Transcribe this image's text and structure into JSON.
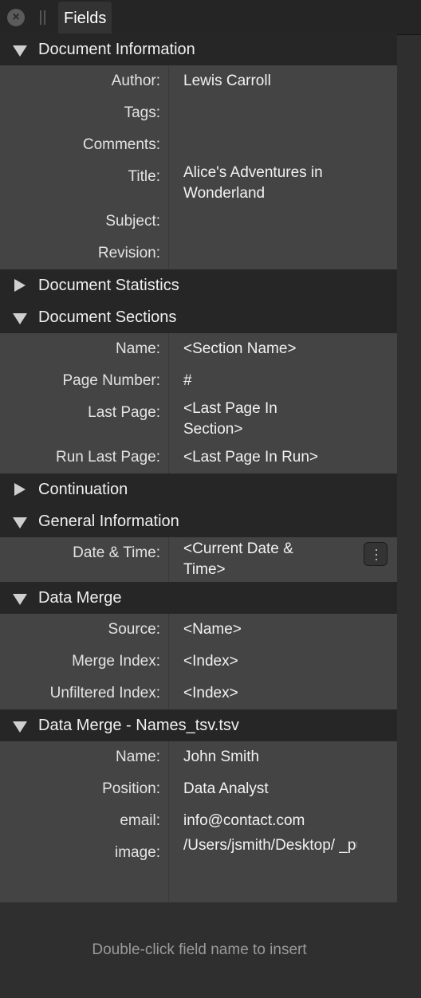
{
  "tabbar": {
    "tab_label": "Fields",
    "close_icon": "close-icon",
    "grip_icon": "drag-grip-icon"
  },
  "sections": {
    "document_information": {
      "title": "Document Information",
      "rows": {
        "author": {
          "label": "Author:",
          "value": "Lewis Carroll"
        },
        "tags": {
          "label": "Tags:",
          "value": ""
        },
        "comments": {
          "label": "Comments:",
          "value": ""
        },
        "title": {
          "label": "Title:",
          "value": "Alice's Adventures in\nWonderland"
        },
        "subject": {
          "label": "Subject:",
          "value": ""
        },
        "revision": {
          "label": "Revision:",
          "value": ""
        }
      }
    },
    "document_statistics": {
      "title": "Document Statistics"
    },
    "document_sections": {
      "title": "Document Sections",
      "rows": {
        "name": {
          "label": "Name:",
          "value": "<Section Name>"
        },
        "page_number": {
          "label": "Page Number:",
          "value": "#"
        },
        "last_page": {
          "label": "Last Page:",
          "value": "<Last Page In\nSection>"
        },
        "run_last_page": {
          "label": "Run Last Page:",
          "value": "<Last Page In Run>"
        }
      }
    },
    "continuation": {
      "title": "Continuation"
    },
    "general_information": {
      "title": "General Information",
      "rows": {
        "date_time": {
          "label": "Date & Time:",
          "value": "<Current Date &\nTime>"
        }
      }
    },
    "data_merge": {
      "title": "Data Merge",
      "rows": {
        "source": {
          "label": "Source:",
          "value": "<Name>"
        },
        "merge_index": {
          "label": "Merge Index:",
          "value": "<Index>"
        },
        "unfiltered_index": {
          "label": "Unfiltered Index:",
          "value": "<Index>"
        }
      }
    },
    "data_merge_names": {
      "title": "Data Merge - Names_tsv.tsv",
      "rows": {
        "name": {
          "label": "Name:",
          "value": "John Smith"
        },
        "position": {
          "label": "Position:",
          "value": "Data Analyst"
        },
        "email": {
          "label": "email:",
          "value": "info@contact.com"
        },
        "image": {
          "label": "image:",
          "value": "/Users/jsmith/Desktop/\n_publisher/dataMerge/\nTest/John.jpg"
        }
      }
    }
  },
  "footer": {
    "hint": "Double-click field name to insert"
  }
}
